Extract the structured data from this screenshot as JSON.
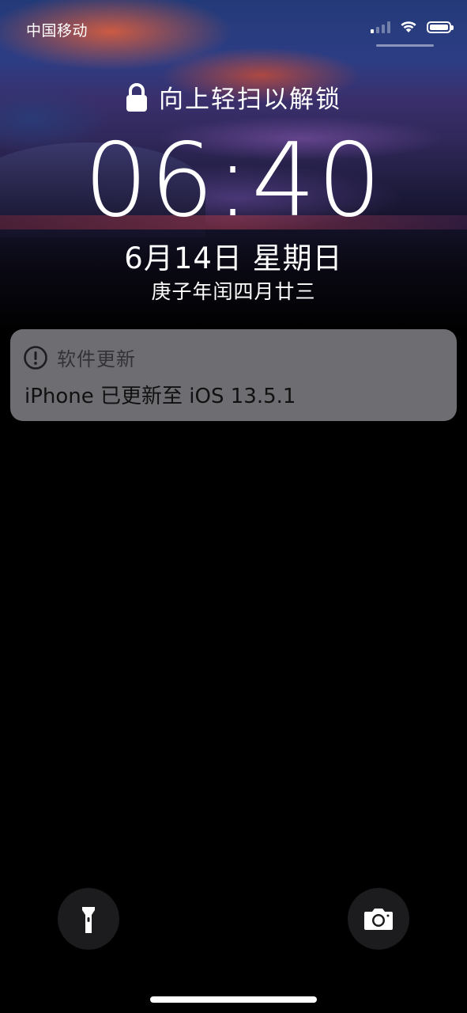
{
  "status_bar": {
    "carrier": "中国移动",
    "signal_bars_active": 1,
    "signal_bars_total": 4,
    "battery_level": 1.0
  },
  "lock_screen": {
    "unlock_hint": "向上轻扫以解锁",
    "time": "06:40",
    "date": "6月14日 星期日",
    "lunar_date": "庚子年闰四月廿三"
  },
  "notification": {
    "app_name": "软件更新",
    "message": "iPhone 已更新至 iOS 13.5.1",
    "icon": "exclamation-circle-icon"
  },
  "quick_actions": {
    "left_icon": "flashlight-icon",
    "right_icon": "camera-icon"
  },
  "colors": {
    "notification_bg": "#6d6d72",
    "button_bg": "#1c1c1e",
    "text": "#ffffff"
  }
}
